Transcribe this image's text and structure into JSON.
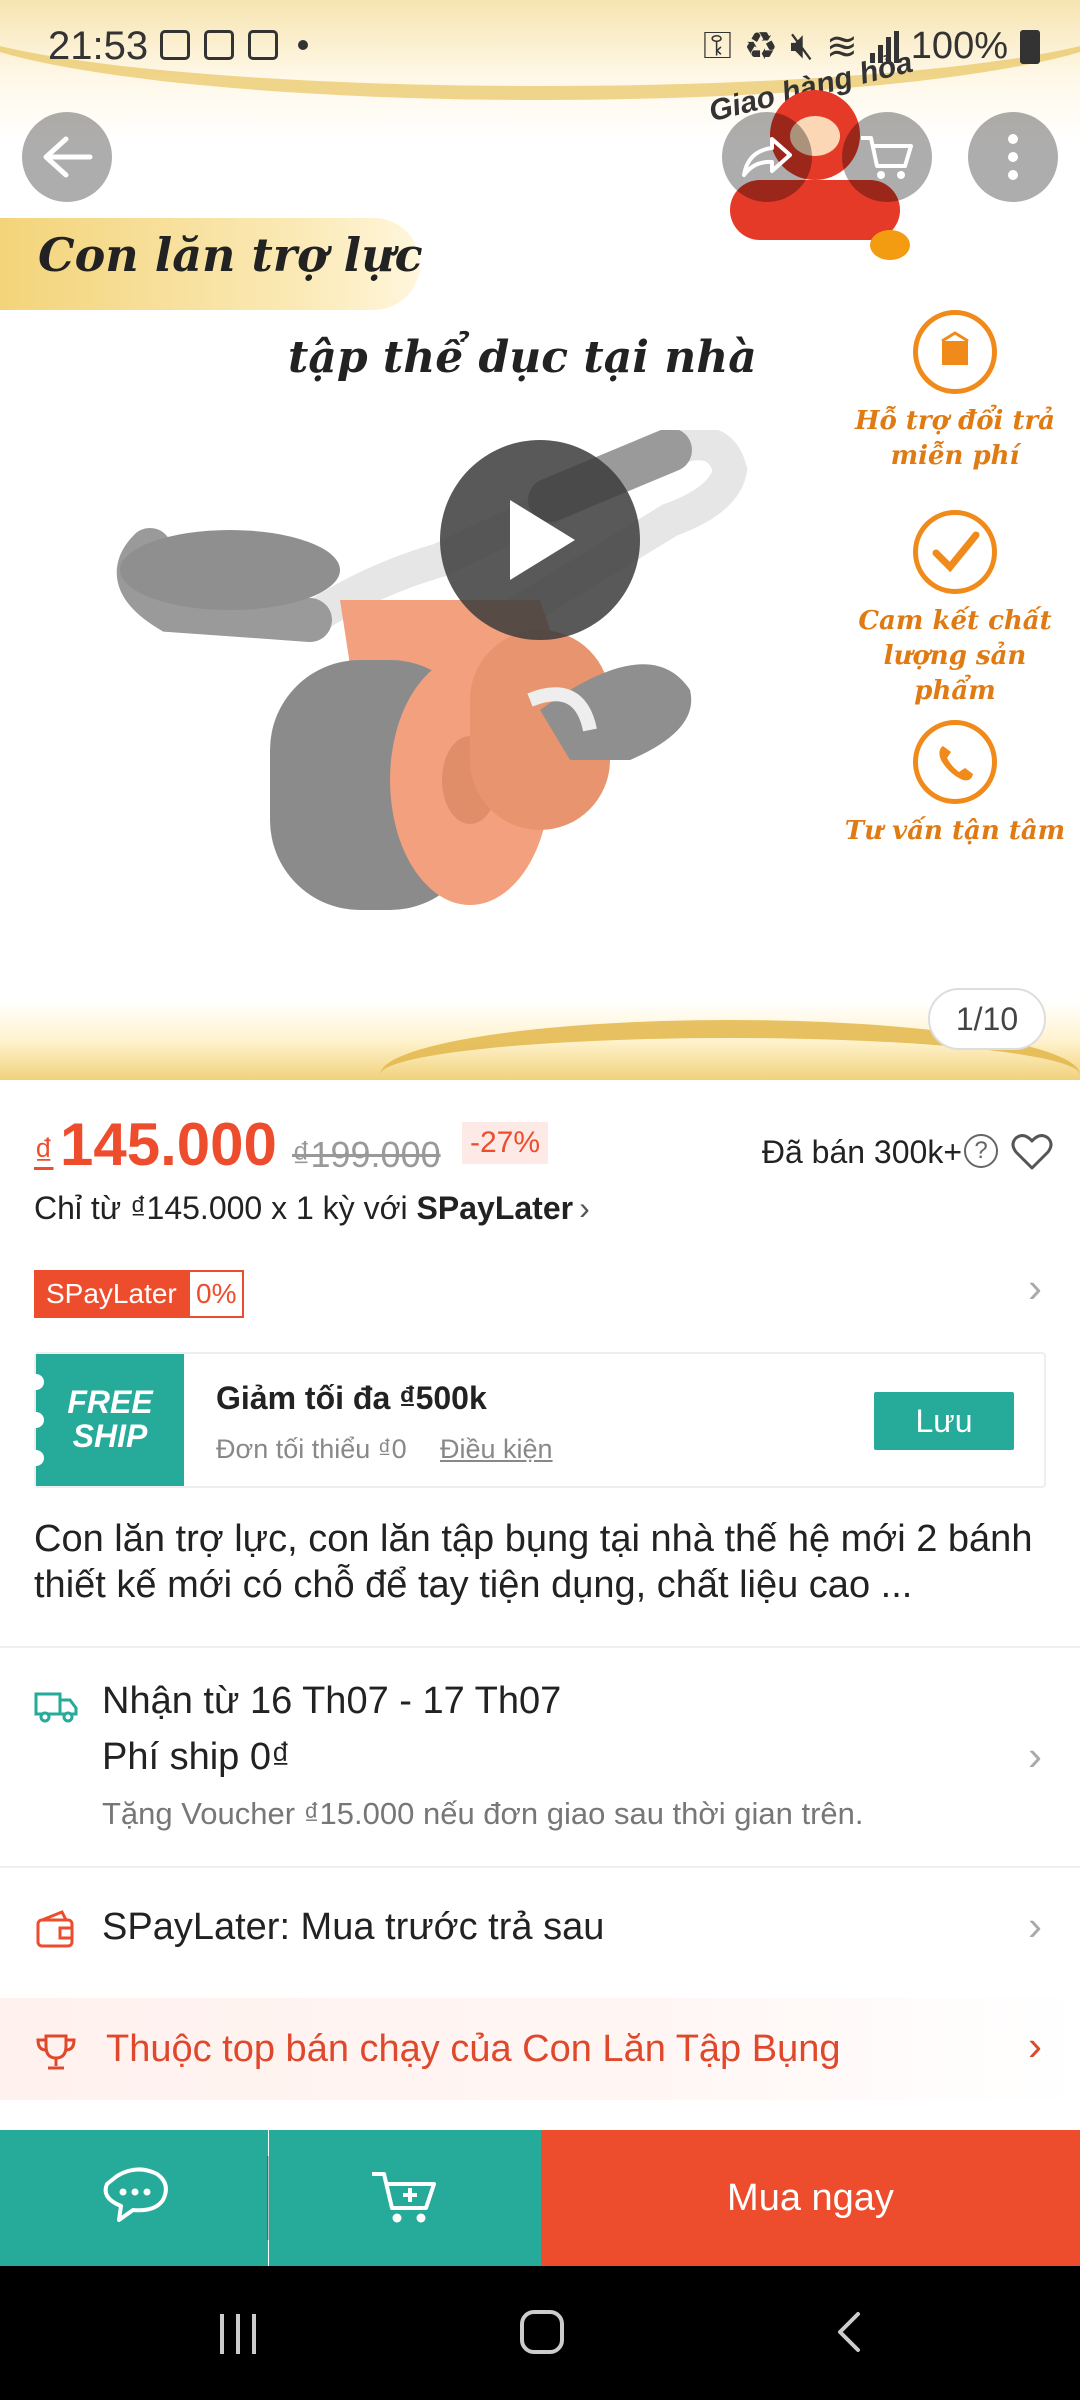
{
  "status_bar": {
    "time": "21:53",
    "battery": "100%",
    "icons": [
      "image-icon",
      "document-icon",
      "clock-icon",
      "dot-icon",
      "key-icon",
      "recycle-icon",
      "mute-icon",
      "wifi-icon",
      "signal-icon",
      "battery-icon"
    ]
  },
  "top_controls": {
    "back_icon": "arrow-left-icon",
    "share_icon": "share-icon",
    "cart_icon": "cart-icon",
    "more_icon": "more-vertical-icon"
  },
  "hero": {
    "banner_title": "Con lăn trợ lực",
    "banner_subtitle": "tập thể dục tại nhà",
    "express_badge": "Giao hàng hỏa tốc",
    "features": [
      {
        "icon": "box-return-icon",
        "label": "Hỗ trợ đổi trả miễn phí"
      },
      {
        "icon": "check-icon",
        "label": "Cam kết chất lượng sản phẩm"
      },
      {
        "icon": "phone-icon",
        "label": "Tư vấn tận tâm"
      }
    ],
    "image_counter": "1/10",
    "play_icon": "play-icon"
  },
  "price": {
    "currency": "₫",
    "current": "145.000",
    "original": "₫199.000",
    "discount": "-27%",
    "sold": "Đã bán 300k+"
  },
  "installment": {
    "text": "Chỉ từ ₫145.000 x 1 kỳ với ",
    "provider": "SPayLater",
    "chevron": "›"
  },
  "spaylater_tag": {
    "label": "SPayLater",
    "rate": "0%"
  },
  "voucher": {
    "badge_line1": "FREE",
    "badge_line2": "SHIP",
    "title": "Giảm tối đa ₫500k",
    "min_order": "Đơn tối thiểu ₫0",
    "conditions": "Điều kiện",
    "save_label": "Lưu"
  },
  "description": "Con lăn trợ lực, con lăn tập bụng tại nhà thế hệ mới 2 bánh thiết kế mới có chỗ để tay tiện dụng, chất liệu cao ...",
  "shipping": {
    "delivery": "Nhận từ 16 Th07 - 17 Th07",
    "fee": "Phí ship 0₫",
    "voucher_note": "Tặng Voucher ₫15.000 nếu đơn giao sau thời gian trên."
  },
  "spaylater_row": {
    "text": "SPayLater: Mua trước trả sau"
  },
  "top_seller": {
    "text": "Thuộc top bán chạy của Con Lăn Tập Bụng"
  },
  "bottom_bar": {
    "chat_icon": "chat-icon",
    "add_cart_icon": "add-to-cart-icon",
    "buy_label": "Mua ngay"
  },
  "colors": {
    "accent": "#ee4d2d",
    "teal": "#26aa99"
  }
}
